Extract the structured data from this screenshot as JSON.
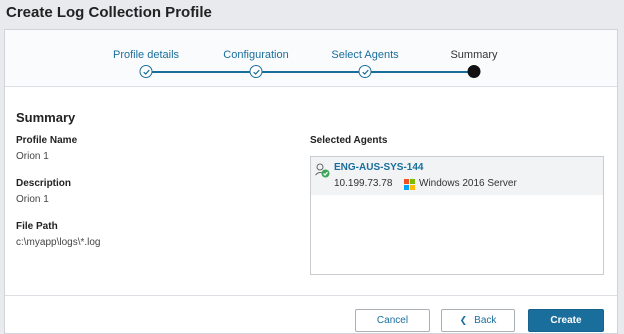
{
  "page": {
    "title": "Create Log Collection Profile"
  },
  "stepper": {
    "steps": [
      {
        "label": "Profile details",
        "state": "completed"
      },
      {
        "label": "Configuration",
        "state": "completed"
      },
      {
        "label": "Select Agents",
        "state": "completed"
      },
      {
        "label": "Summary",
        "state": "current"
      }
    ]
  },
  "summary": {
    "title": "Summary",
    "profile_name_label": "Profile Name",
    "profile_name_value": "Orion 1",
    "description_label": "Description",
    "description_value": "Orion 1",
    "file_path_label": "File Path",
    "file_path_value": "c:\\myapp\\logs\\*.log"
  },
  "agents": {
    "label": "Selected Agents",
    "items": [
      {
        "name": "ENG-AUS-SYS-144",
        "ip": "10.199.73.78",
        "os": "Windows 2016 Server",
        "status_icon": "agent-online-icon",
        "os_icon": "windows-icon"
      }
    ]
  },
  "footer": {
    "cancel_label": "Cancel",
    "back_label": "Back",
    "create_label": "Create"
  },
  "colors": {
    "accent": "#1a6e9c",
    "status_ok": "#3aa657",
    "background": "#e8eaed"
  }
}
